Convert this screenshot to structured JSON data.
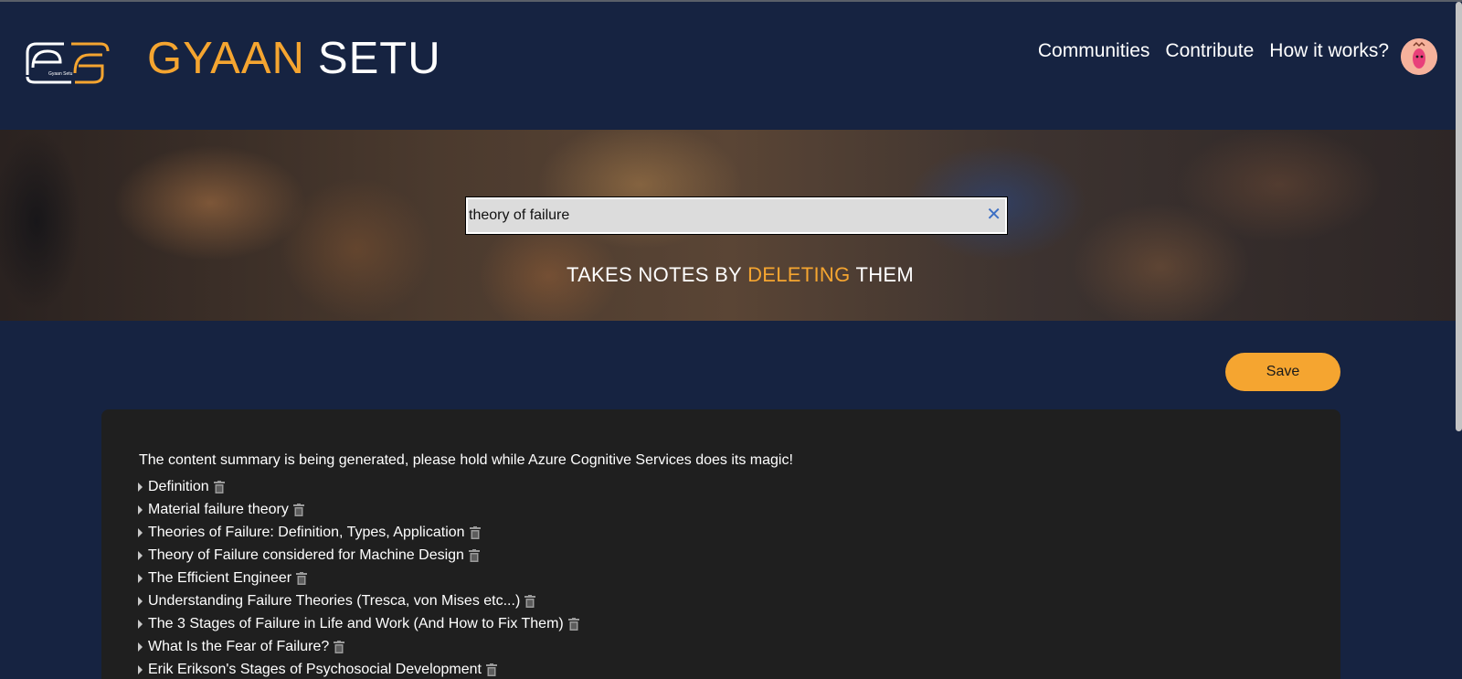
{
  "header": {
    "logo_icon": "gyaan-setu-logo-icon",
    "logo_text": "Gyaan Setu",
    "brand_part1": "GYAAN",
    "brand_part2": "SETU",
    "nav": [
      "Communities",
      "Contribute",
      "How it works?"
    ],
    "avatar_icon": "user-avatar-icon"
  },
  "hero": {
    "search_value": "theory of failure",
    "clear_icon": "close-icon",
    "tagline_part1": "TAKES NOTES BY",
    "tagline_highlight": "DELETING",
    "tagline_part2": "THEM"
  },
  "actions": {
    "save_label": "Save"
  },
  "results": {
    "summary": "The content summary is being generated, please hold while Azure Cognitive Services does its magic!",
    "items": [
      "Definition",
      "Material failure theory",
      "Theories of Failure: Definition, Types, Application",
      "Theory of Failure considered for Machine Design",
      "The Efficient Engineer",
      "Understanding Failure Theories (Tresca, von Mises etc...)",
      "The 3 Stages of Failure in Life and Work (And How to Fix Them)",
      "What Is the Fear of Failure?",
      "Erik Erikson's Stages of Psychosocial Development"
    ],
    "expand_icon": "caret-right-icon",
    "delete_icon": "trash-icon"
  },
  "colors": {
    "accent": "#f5a530",
    "background": "#162341",
    "panel": "#1f1f1f"
  }
}
